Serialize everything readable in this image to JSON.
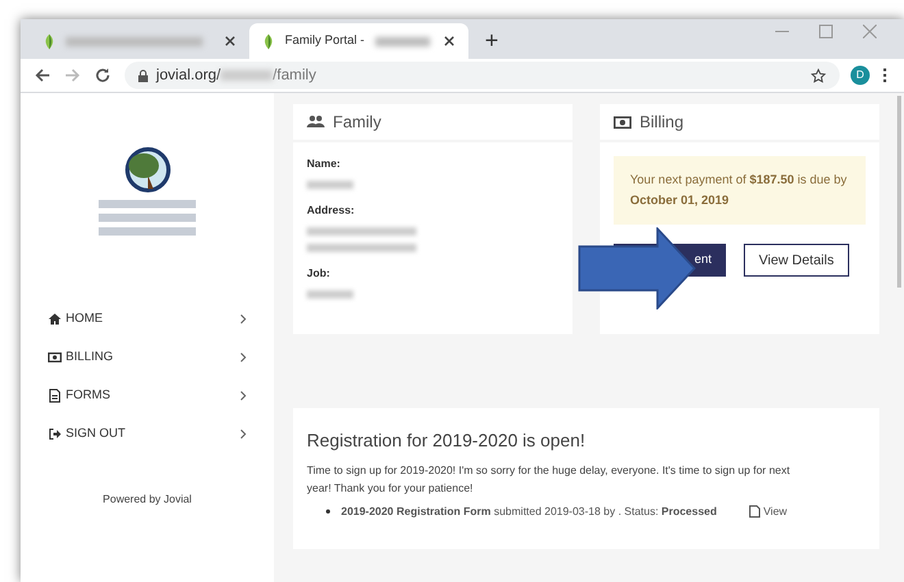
{
  "browser": {
    "tabs": [
      {
        "selected": false
      },
      {
        "title": "Family Portal -",
        "selected": true
      }
    ],
    "new_tab": "+",
    "url_start": "jovial.org/",
    "url_end": "/family",
    "profile_initial": "D"
  },
  "sidebar": {
    "items": [
      {
        "kind": "home",
        "label": "HOME"
      },
      {
        "kind": "billing",
        "label": "BILLING"
      },
      {
        "kind": "forms",
        "label": "FORMS"
      },
      {
        "kind": "signout",
        "label": "SIGN OUT"
      }
    ],
    "footer": "Powered by Jovial"
  },
  "family": {
    "title": "Family",
    "fields": [
      {
        "label": "Name:",
        "kind": "single"
      },
      {
        "label": "Address:",
        "kind": "double"
      },
      {
        "label": "Job:",
        "kind": "single"
      }
    ]
  },
  "billing": {
    "title": "Billing",
    "notice": "Your next payment of **$187.50** is due by **October 01, 2019**",
    "pay_button": "ent",
    "details_button": "View Details"
  },
  "announcement": {
    "title": "Registration for 2019-2020 is open!",
    "body": "Time to sign up for 2019-2020! I'm so sorry for the huge delay, everyone. It's time to sign up for next year! Thank you for your patience!",
    "items": [
      {
        "text": "**2019-2020 Registration Form** submitted 2019-03-18 by . Status: **Processed**",
        "link": "View"
      }
    ]
  }
}
